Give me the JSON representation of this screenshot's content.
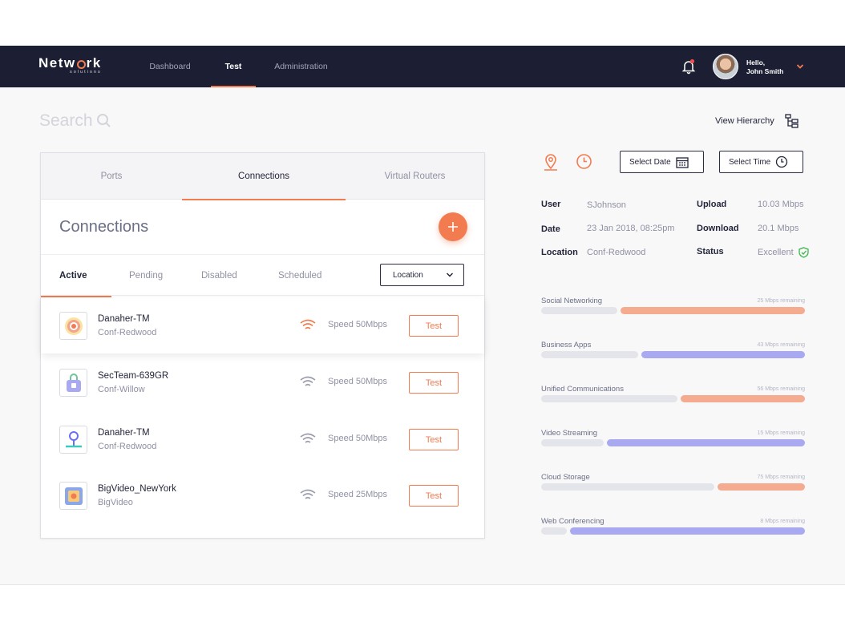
{
  "app": {
    "logo_text_start": "Netw",
    "logo_text_end": "rk",
    "logo_sub": "solutions"
  },
  "nav": {
    "items": [
      {
        "label": "Dashboard",
        "active": false
      },
      {
        "label": "Test",
        "active": true
      },
      {
        "label": "Administration",
        "active": false
      }
    ]
  },
  "user": {
    "greeting": "Hello,",
    "name": "John Smith"
  },
  "search": {
    "placeholder": "Search"
  },
  "view_hierarchy_label": "View Hierarchy",
  "card": {
    "tabs": [
      {
        "label": "Ports",
        "active": false
      },
      {
        "label": "Connections",
        "active": true
      },
      {
        "label": "Virtual Routers",
        "active": false
      }
    ],
    "title": "Connections",
    "add_symbol": "+",
    "filters": [
      {
        "label": "Active",
        "active": true
      },
      {
        "label": "Pending",
        "active": false
      },
      {
        "label": "Disabled",
        "active": false
      },
      {
        "label": "Scheduled",
        "active": false
      }
    ],
    "location_select": "Location",
    "rows": [
      {
        "name": "Danaher-TM",
        "sub": "Conf-Redwood",
        "speed": "Speed 50Mbps",
        "action": "Test",
        "icon": "target-icon",
        "wifi_color": "#f27b50"
      },
      {
        "name": "SecTeam-639GR",
        "sub": "Conf-Willow",
        "speed": "Speed 50Mbps",
        "action": "Test",
        "icon": "lock-icon",
        "wifi_color": "#9a9cab"
      },
      {
        "name": "Danaher-TM",
        "sub": "Conf-Redwood",
        "speed": "Speed 50Mbps",
        "action": "Test",
        "icon": "pin-icon",
        "wifi_color": "#9a9cab"
      },
      {
        "name": "BigVideo_NewYork",
        "sub": "BigVideo",
        "speed": "Speed 25Mbps",
        "action": "Test",
        "icon": "video-icon",
        "wifi_color": "#9a9cab"
      }
    ]
  },
  "controls": {
    "select_date": "Select Date",
    "select_time": "Select Time"
  },
  "info": {
    "user_label": "User",
    "user_value": "SJohnson",
    "date_label": "Date",
    "date_value": "23 Jan 2018, 08:25pm",
    "location_label": "Location",
    "location_value": "Conf-Redwood",
    "upload_label": "Upload",
    "upload_value": "10.03 Mbps",
    "download_label": "Download",
    "download_value": "20.1 Mbps",
    "status_label": "Status",
    "status_value": "Excellent"
  },
  "bandwidth": [
    {
      "label": "Social Networking",
      "remaining": "25 Mbps remaining",
      "used_fraction": 0.3,
      "color": "#f5ab90"
    },
    {
      "label": "Business Apps",
      "remaining": "43 Mbps remaining",
      "used_fraction": 0.38,
      "color": "#a8a9f1"
    },
    {
      "label": "Unified Communications",
      "remaining": "56 Mbps remaining",
      "used_fraction": 0.53,
      "color": "#f5ab90"
    },
    {
      "label": "Video Streaming",
      "remaining": "15 Mbps remaining",
      "used_fraction": 0.25,
      "color": "#a8a9f1"
    },
    {
      "label": "Cloud Storage",
      "remaining": "75 Mbps remaining",
      "used_fraction": 0.67,
      "color": "#f5ab90"
    },
    {
      "label": "Web Conferencing",
      "remaining": "8 Mbps remaining",
      "used_fraction": 0.11,
      "color": "#a8a9f1"
    }
  ],
  "colors": {
    "accent": "#f27b50",
    "navbar": "#1c1f33",
    "status_ok": "#3bb54a"
  }
}
